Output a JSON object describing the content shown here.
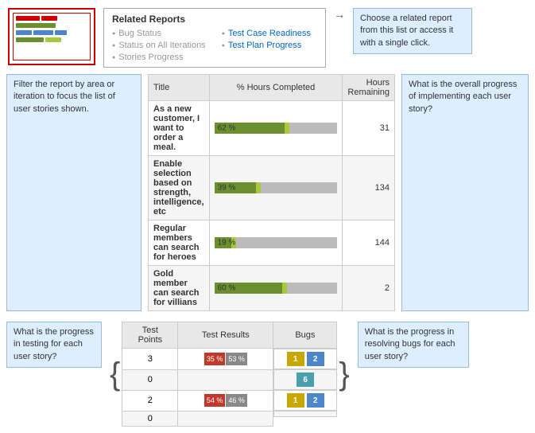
{
  "relatedReports": {
    "title": "Related Reports",
    "col1": [
      {
        "label": "Bug Status",
        "active": false
      },
      {
        "label": "Status on All Iterations",
        "active": false
      },
      {
        "label": "Stories Progress",
        "active": false
      }
    ],
    "col2": [
      {
        "label": "Test Case Readiness",
        "active": true
      },
      {
        "label": "Test Plan Progress",
        "active": true
      }
    ]
  },
  "callouts": {
    "relatedReportsHint": "Choose a related report from this list or access it with a single click.",
    "filterHint": "Filter the report by area or iteration to focus the list of user stories shown.",
    "progressHint": "What is the overall progress of implementing each user story?",
    "testingHint": "What is the progress in testing for each user story?",
    "bugsHint": "What is the progress in resolving bugs for each user story?"
  },
  "storiesTable": {
    "headers": {
      "title": "Title",
      "hoursCompleted": "% Hours Completed",
      "hoursRemaining": "Hours\nRemaining"
    },
    "rows": [
      {
        "title": "As a new customer, I want to order a meal.",
        "percent": "62 %",
        "percentValue": 62,
        "hoursRemaining": "31"
      },
      {
        "title": "Enable selection based on strength, intelligence, etc",
        "percent": "39 %",
        "percentValue": 39,
        "hoursRemaining": "134"
      },
      {
        "title": "Regular members can search for heroes",
        "percent": "19 %",
        "percentValue": 19,
        "hoursRemaining": "144"
      },
      {
        "title": "Gold member can search for villians",
        "percent": "60 %",
        "percentValue": 60,
        "hoursRemaining": "2"
      }
    ]
  },
  "testTable": {
    "headers": {
      "testPoints": "Test Points",
      "testResults": "Test Results",
      "bugs": "Bugs"
    },
    "rows": [
      {
        "testPoints": "3",
        "hasResults": true,
        "redPct": "35 %",
        "grayPct": "53 %",
        "bug1": "1",
        "bug2": "2",
        "bug1Color": "yellow",
        "bug2Color": "blue"
      },
      {
        "testPoints": "0",
        "hasResults": false,
        "redPct": "",
        "grayPct": "",
        "bug1": "",
        "bug2": "6",
        "bug1Color": "",
        "bug2Color": "teal"
      },
      {
        "testPoints": "2",
        "hasResults": true,
        "redPct": "54 %",
        "grayPct": "46 %",
        "bug1": "1",
        "bug2": "2",
        "bug1Color": "yellow",
        "bug2Color": "blue"
      },
      {
        "testPoints": "0",
        "hasResults": false,
        "redPct": "",
        "grayPct": "",
        "bug1": "",
        "bug2": "",
        "bug1Color": "",
        "bug2Color": ""
      }
    ]
  }
}
